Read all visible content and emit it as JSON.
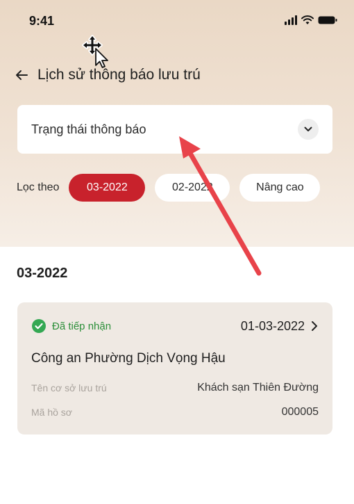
{
  "status_bar": {
    "time": "9:41",
    "icons": [
      "signal-icon",
      "wifi-icon",
      "battery-icon"
    ]
  },
  "header": {
    "back_icon": "back-arrow-icon",
    "title": "Lịch sử thông báo lưu trú"
  },
  "status_filter": {
    "label": "Trạng thái thông báo",
    "icon": "chevron-down-icon"
  },
  "filter_row": {
    "label": "Lọc theo",
    "chips": [
      {
        "label": "03-2022",
        "active": true
      },
      {
        "label": "02-2022",
        "active": false
      },
      {
        "label": "Nâng cao",
        "active": false
      }
    ]
  },
  "section": {
    "title": "03-2022"
  },
  "card": {
    "status": "Đã tiếp nhận",
    "status_icon": "check-circle-icon",
    "date": "01-03-2022",
    "title": "Công an Phường Dịch Vọng Hậu",
    "rows": [
      {
        "label": "Tên cơ sở lưu trú",
        "value": "Khách sạn Thiên Đường"
      },
      {
        "label": "Mã hồ sơ",
        "value": "000005"
      }
    ]
  },
  "colors": {
    "accent": "#c8222c",
    "success": "#2c8f3a",
    "annotation_arrow": "#e8434a"
  }
}
